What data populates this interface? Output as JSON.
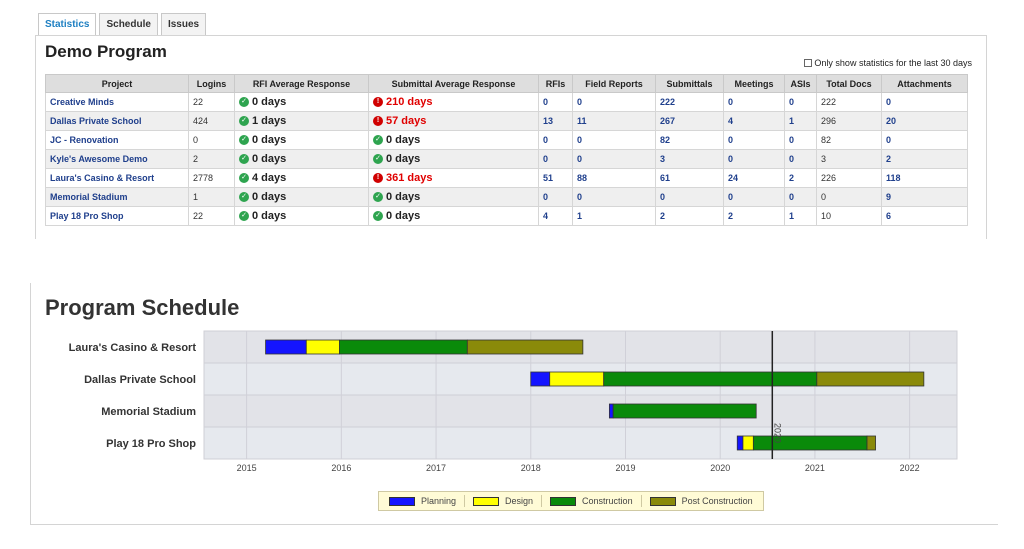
{
  "tabs": [
    {
      "label": "Statistics",
      "active": true
    },
    {
      "label": "Schedule",
      "active": false
    },
    {
      "label": "Issues",
      "active": false
    }
  ],
  "stats": {
    "title": "Demo Program",
    "last30_label": "Only show statistics for the last 30 days",
    "columns": [
      "Project",
      "Logins",
      "RFI Average Response",
      "Submittal Average Response",
      "RFIs",
      "Field Reports",
      "Submittals",
      "Meetings",
      "ASIs",
      "Total Docs",
      "Attachments"
    ],
    "rows": [
      {
        "project": "Creative Minds",
        "logins": "22",
        "rfi": "0 days",
        "rfi_status": "good",
        "submittal": "210 days",
        "submittal_status": "bad",
        "rfis": "0",
        "field_reports": "0",
        "submittals": "222",
        "meetings": "0",
        "asis": "0",
        "total_docs": "222",
        "attachments": "0"
      },
      {
        "project": "Dallas Private School",
        "logins": "424",
        "rfi": "1 days",
        "rfi_status": "good",
        "submittal": "57 days",
        "submittal_status": "bad",
        "rfis": "13",
        "field_reports": "11",
        "submittals": "267",
        "meetings": "4",
        "asis": "1",
        "total_docs": "296",
        "attachments": "20"
      },
      {
        "project": "JC - Renovation",
        "logins": "0",
        "rfi": "0 days",
        "rfi_status": "good",
        "submittal": "0 days",
        "submittal_status": "good",
        "rfis": "0",
        "field_reports": "0",
        "submittals": "82",
        "meetings": "0",
        "asis": "0",
        "total_docs": "82",
        "attachments": "0"
      },
      {
        "project": "Kyle's Awesome Demo",
        "logins": "2",
        "rfi": "0 days",
        "rfi_status": "good",
        "submittal": "0 days",
        "submittal_status": "good",
        "rfis": "0",
        "field_reports": "0",
        "submittals": "3",
        "meetings": "0",
        "asis": "0",
        "total_docs": "3",
        "attachments": "2"
      },
      {
        "project": "Laura's Casino & Resort",
        "logins": "2778",
        "rfi": "4 days",
        "rfi_status": "good",
        "submittal": "361 days",
        "submittal_status": "bad",
        "rfis": "51",
        "field_reports": "88",
        "submittals": "61",
        "meetings": "24",
        "asis": "2",
        "total_docs": "226",
        "attachments": "118"
      },
      {
        "project": "Memorial Stadium",
        "logins": "1",
        "rfi": "0 days",
        "rfi_status": "good",
        "submittal": "0 days",
        "submittal_status": "good",
        "rfis": "0",
        "field_reports": "0",
        "submittals": "0",
        "meetings": "0",
        "asis": "0",
        "total_docs": "0",
        "attachments": "9"
      },
      {
        "project": "Play 18 Pro Shop",
        "logins": "22",
        "rfi": "0 days",
        "rfi_status": "good",
        "submittal": "0 days",
        "submittal_status": "good",
        "rfis": "4",
        "field_reports": "1",
        "submittals": "2",
        "meetings": "2",
        "asis": "1",
        "total_docs": "10",
        "attachments": "6"
      }
    ]
  },
  "schedule": {
    "title": "Program Schedule",
    "today_marker_label": "2020",
    "today_marker_date": 2020.55,
    "x_ticks": [
      "2015",
      "2016",
      "2017",
      "2018",
      "2019",
      "2020",
      "2021",
      "2022"
    ],
    "phase_colors": {
      "Planning": "#1414ff",
      "Design": "#ffff00",
      "Construction": "#0a8a0a",
      "Post Construction": "#8a8a0a"
    },
    "legend": [
      "Planning",
      "Design",
      "Construction",
      "Post Construction"
    ],
    "projects": [
      {
        "name": "Laura's Casino & Resort",
        "phases": [
          {
            "phase": "Planning",
            "start": 2015.2,
            "end": 2015.63
          },
          {
            "phase": "Design",
            "start": 2015.63,
            "end": 2015.98
          },
          {
            "phase": "Construction",
            "start": 2015.98,
            "end": 2017.33
          },
          {
            "phase": "Post Construction",
            "start": 2017.33,
            "end": 2018.55
          }
        ]
      },
      {
        "name": "Dallas Private School",
        "phases": [
          {
            "phase": "Planning",
            "start": 2018.0,
            "end": 2018.2
          },
          {
            "phase": "Design",
            "start": 2018.2,
            "end": 2018.77
          },
          {
            "phase": "Construction",
            "start": 2018.77,
            "end": 2021.02
          },
          {
            "phase": "Post Construction",
            "start": 2021.02,
            "end": 2022.15
          }
        ]
      },
      {
        "name": "Memorial Stadium",
        "phases": [
          {
            "phase": "Planning",
            "start": 2018.83,
            "end": 2018.87
          },
          {
            "phase": "Construction",
            "start": 2018.87,
            "end": 2020.38
          }
        ]
      },
      {
        "name": "Play 18 Pro Shop",
        "phases": [
          {
            "phase": "Planning",
            "start": 2020.18,
            "end": 2020.24
          },
          {
            "phase": "Design",
            "start": 2020.24,
            "end": 2020.35
          },
          {
            "phase": "Construction",
            "start": 2020.35,
            "end": 2021.55
          },
          {
            "phase": "Post Construction",
            "start": 2021.55,
            "end": 2021.64
          }
        ]
      }
    ]
  }
}
